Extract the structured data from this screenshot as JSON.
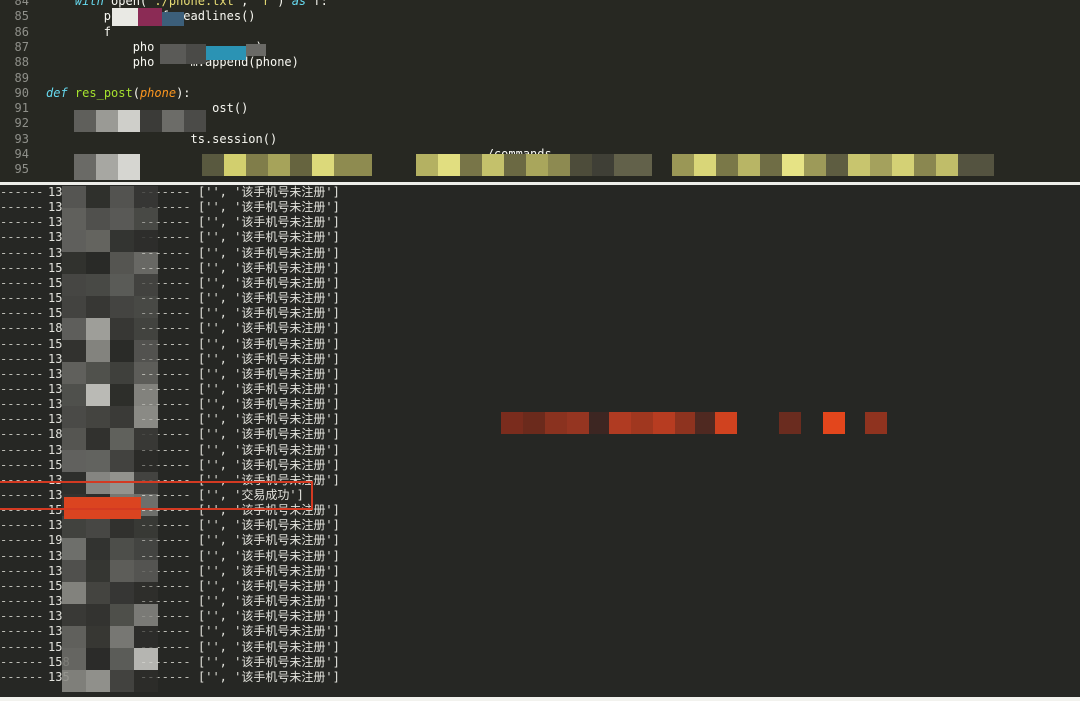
{
  "editor": {
    "lines": [
      {
        "n": "84",
        "parts": [
          [
            "",
            "    "
          ],
          [
            "kw",
            "with"
          ],
          [
            "",
            " open("
          ],
          [
            "str",
            "'./phone.txt'"
          ],
          [
            "",
            ", "
          ],
          [
            "str",
            "'r'"
          ],
          [
            "",
            ") "
          ],
          [
            "kw",
            "as"
          ],
          [
            "",
            " f:"
          ]
        ]
      },
      {
        "n": "85",
        "parts": [
          [
            "",
            "        p"
          ],
          [
            "",
            "       "
          ],
          [
            "",
            "f.readlines()"
          ]
        ]
      },
      {
        "n": "86",
        "parts": [
          [
            "",
            "        f"
          ]
        ]
      },
      {
        "n": "87",
        "parts": [
          [
            "",
            "            pho"
          ],
          [
            "",
            "              "
          ],
          [
            "",
            ")"
          ]
        ]
      },
      {
        "n": "88",
        "parts": [
          [
            "",
            "            pho"
          ],
          [
            "",
            "     "
          ],
          [
            "",
            "m.append(phone)"
          ]
        ]
      },
      {
        "n": "89",
        "parts": []
      },
      {
        "n": "90",
        "parts": [
          [
            "kw",
            "def"
          ],
          [
            "",
            " "
          ],
          [
            "fn",
            "res_post"
          ],
          [
            "",
            "("
          ],
          [
            "param",
            "phone"
          ],
          [
            "",
            "):"
          ]
        ]
      },
      {
        "n": "91",
        "parts": [
          [
            "",
            "            "
          ],
          [
            "",
            "      "
          ],
          [
            "",
            "     ost()"
          ]
        ]
      },
      {
        "n": "92",
        "parts": []
      },
      {
        "n": "93",
        "parts": [
          [
            "",
            "                    "
          ],
          [
            "",
            "ts.session()"
          ]
        ]
      },
      {
        "n": "94",
        "parts": [
          [
            "",
            "                                                            "
          ],
          [
            "",
            "./commands"
          ]
        ]
      },
      {
        "n": "95",
        "parts": [
          [
            "",
            "                                                                                                     "
          ],
          [
            "",
            "352556"
          ]
        ]
      }
    ]
  },
  "console": {
    "rows": [
      {
        "num": "13",
        "text": "['', '该手机号未注册']"
      },
      {
        "num": "13",
        "text": "['', '该手机号未注册']"
      },
      {
        "num": "13",
        "text": "['', '该手机号未注册']"
      },
      {
        "num": "13",
        "text": "['', '该手机号未注册']"
      },
      {
        "num": "13",
        "text": "['', '该手机号未注册']"
      },
      {
        "num": "15",
        "text": "['', '该手机号未注册']"
      },
      {
        "num": "15",
        "text": "['', '该手机号未注册']"
      },
      {
        "num": "15",
        "text": "['', '该手机号未注册']"
      },
      {
        "num": "15",
        "text": "['', '该手机号未注册']"
      },
      {
        "num": "18",
        "text": "['', '该手机号未注册']"
      },
      {
        "num": "15",
        "text": "['', '该手机号未注册']"
      },
      {
        "num": "13",
        "text": "['', '该手机号未注册']"
      },
      {
        "num": "13",
        "text": "['', '该手机号未注册']"
      },
      {
        "num": "13",
        "text": "['', '该手机号未注册']"
      },
      {
        "num": "13",
        "text": "['', '该手机号未注册']"
      },
      {
        "num": "13",
        "text": "['', '该手机号未注册']"
      },
      {
        "num": "18",
        "text": "['', '该手机号未注册']"
      },
      {
        "num": "13",
        "text": "['', '该手机号未注册']"
      },
      {
        "num": "15",
        "text": "['', '该手机号未注册']"
      },
      {
        "num": "13",
        "text": "['', '该手机号未注册']"
      },
      {
        "num": "13",
        "text": "['', '交易成功']",
        "highlight": true
      },
      {
        "num": "15",
        "text": "['', '该手机号未注册']"
      },
      {
        "num": "13",
        "text": "['', '该手机号未注册']"
      },
      {
        "num": "19",
        "text": "['', '该手机号未注册']"
      },
      {
        "num": "13",
        "text": "['', '该手机号未注册']"
      },
      {
        "num": "13",
        "text": "['', '该手机号未注册']"
      },
      {
        "num": "15",
        "text": "['', '该手机号未注册']"
      },
      {
        "num": "13",
        "text": "['', '该手机号未注册']"
      },
      {
        "num": "13",
        "text": "['', '该手机号未注册']"
      },
      {
        "num": "13",
        "text": "['', '该手机号未注册']"
      },
      {
        "num": "15",
        "text": "['', '该手机号未注册']"
      },
      {
        "num": "158",
        "text": "['', '该手机号未注册']"
      },
      {
        "num": "135",
        "text": "['', '该手机号未注册']"
      }
    ]
  },
  "colors": {
    "editor_bg": "#272822",
    "console_bg": "#262724",
    "highlight_border": "#d33a22",
    "keyword": "#66d9ef",
    "function": "#a6e22e",
    "param": "#fd971f",
    "string": "#e6db74"
  }
}
